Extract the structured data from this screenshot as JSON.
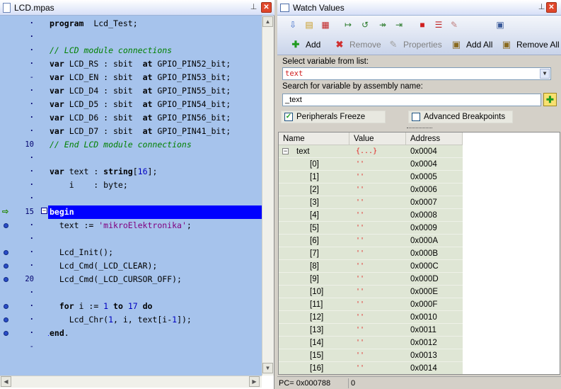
{
  "editor": {
    "title": "LCD.mpas",
    "gutter_numbers": [
      "10",
      "15",
      "20"
    ],
    "lines": [
      {
        "parts": [
          [
            "kw",
            "program"
          ],
          [
            "n",
            "  Lcd_Test;"
          ]
        ]
      },
      {
        "parts": []
      },
      {
        "parts": [
          [
            "cm",
            "// LCD module connections"
          ]
        ]
      },
      {
        "parts": [
          [
            "kw",
            "var"
          ],
          [
            "n",
            " LCD_RS : sbit  "
          ],
          [
            "kw",
            "at"
          ],
          [
            "n",
            " GPIO_PIN52_bit;"
          ]
        ]
      },
      {
        "parts": [
          [
            "kw",
            "var"
          ],
          [
            "n",
            " LCD_EN : sbit  "
          ],
          [
            "kw",
            "at"
          ],
          [
            "n",
            " GPIO_PIN53_bit;"
          ]
        ]
      },
      {
        "parts": [
          [
            "kw",
            "var"
          ],
          [
            "n",
            " LCD_D4 : sbit  "
          ],
          [
            "kw",
            "at"
          ],
          [
            "n",
            " GPIO_PIN55_bit;"
          ]
        ]
      },
      {
        "parts": [
          [
            "kw",
            "var"
          ],
          [
            "n",
            " LCD_D5 : sbit  "
          ],
          [
            "kw",
            "at"
          ],
          [
            "n",
            " GPIO_PIN54_bit;"
          ]
        ]
      },
      {
        "parts": [
          [
            "kw",
            "var"
          ],
          [
            "n",
            " LCD_D6 : sbit  "
          ],
          [
            "kw",
            "at"
          ],
          [
            "n",
            " GPIO_PIN56_bit;"
          ]
        ]
      },
      {
        "parts": [
          [
            "kw",
            "var"
          ],
          [
            "n",
            " LCD_D7 : sbit  "
          ],
          [
            "kw",
            "at"
          ],
          [
            "n",
            " GPIO_PIN41_bit;"
          ]
        ]
      },
      {
        "parts": [
          [
            "cm",
            "// End LCD module connections"
          ]
        ]
      },
      {
        "parts": []
      },
      {
        "parts": [
          [
            "kw",
            "var"
          ],
          [
            "n",
            " text : "
          ],
          [
            "kw",
            "string"
          ],
          [
            "n",
            "["
          ],
          [
            "nm",
            "16"
          ],
          [
            "n",
            "];"
          ]
        ]
      },
      {
        "parts": [
          [
            "n",
            "    i    : byte;"
          ]
        ]
      },
      {
        "parts": []
      },
      {
        "parts": [
          [
            "kw",
            "begin"
          ]
        ],
        "current": true
      },
      {
        "parts": [
          [
            "n",
            "  text := "
          ],
          [
            "st",
            "'mikroElektronika'"
          ],
          [
            "n",
            ";"
          ]
        ]
      },
      {
        "parts": []
      },
      {
        "parts": [
          [
            "n",
            "  Lcd_Init();"
          ]
        ]
      },
      {
        "parts": [
          [
            "n",
            "  Lcd_Cmd(_LCD_CLEAR);"
          ]
        ]
      },
      {
        "parts": [
          [
            "n",
            "  Lcd_Cmd(_LCD_CURSOR_OFF);"
          ]
        ]
      },
      {
        "parts": []
      },
      {
        "parts": [
          [
            "kw",
            "  for"
          ],
          [
            "n",
            " i := "
          ],
          [
            "nm",
            "1"
          ],
          [
            "kw",
            " to"
          ],
          [
            "n",
            " "
          ],
          [
            "nm",
            "17"
          ],
          [
            "kw",
            " do"
          ]
        ]
      },
      {
        "parts": [
          [
            "n",
            "    Lcd_Chr("
          ],
          [
            "nm",
            "1"
          ],
          [
            "n",
            ", i, text[i-"
          ],
          [
            "nm",
            "1"
          ],
          [
            "n",
            "]);"
          ]
        ]
      },
      {
        "parts": [
          [
            "kw",
            "end"
          ],
          [
            "n",
            "."
          ]
        ]
      }
    ]
  },
  "watch": {
    "title": "Watch Values",
    "buttons": {
      "add": "Add",
      "remove": "Remove",
      "properties": "Properties",
      "add_all": "Add All",
      "remove_all": "Remove All"
    },
    "select_label": "Select variable from list:",
    "select_value": "text",
    "search_label": "Search for variable by assembly name:",
    "search_value": "_text",
    "peripherals_freeze": "Peripherals Freeze",
    "advanced_breakpoints": "Advanced Breakpoints",
    "columns": [
      "Name",
      "Value",
      "Address"
    ],
    "rows": [
      {
        "name": "text",
        "value": "{...}",
        "address": "0x0004",
        "expanded": true
      },
      {
        "name": "[0]",
        "value": "''",
        "address": "0x0004"
      },
      {
        "name": "[1]",
        "value": "''",
        "address": "0x0005"
      },
      {
        "name": "[2]",
        "value": "''",
        "address": "0x0006"
      },
      {
        "name": "[3]",
        "value": "''",
        "address": "0x0007"
      },
      {
        "name": "[4]",
        "value": "''",
        "address": "0x0008"
      },
      {
        "name": "[5]",
        "value": "''",
        "address": "0x0009"
      },
      {
        "name": "[6]",
        "value": "''",
        "address": "0x000A"
      },
      {
        "name": "[7]",
        "value": "''",
        "address": "0x000B"
      },
      {
        "name": "[8]",
        "value": "''",
        "address": "0x000C"
      },
      {
        "name": "[9]",
        "value": "''",
        "address": "0x000D"
      },
      {
        "name": "[10]",
        "value": "''",
        "address": "0x000E"
      },
      {
        "name": "[11]",
        "value": "''",
        "address": "0x000F"
      },
      {
        "name": "[12]",
        "value": "''",
        "address": "0x0010"
      },
      {
        "name": "[13]",
        "value": "''",
        "address": "0x0011"
      },
      {
        "name": "[14]",
        "value": "''",
        "address": "0x0012"
      },
      {
        "name": "[15]",
        "value": "''",
        "address": "0x0013"
      },
      {
        "name": "[16]",
        "value": "''",
        "address": "0x0014"
      }
    ],
    "status_pc": "PC= 0x000788",
    "status_val": "0"
  },
  "colors": {
    "editor_bg": "#a6c3ec",
    "current_line": "#0000ff",
    "keyword": "#000000",
    "comment": "#008000",
    "string": "#800080",
    "number": "#0000c0"
  }
}
